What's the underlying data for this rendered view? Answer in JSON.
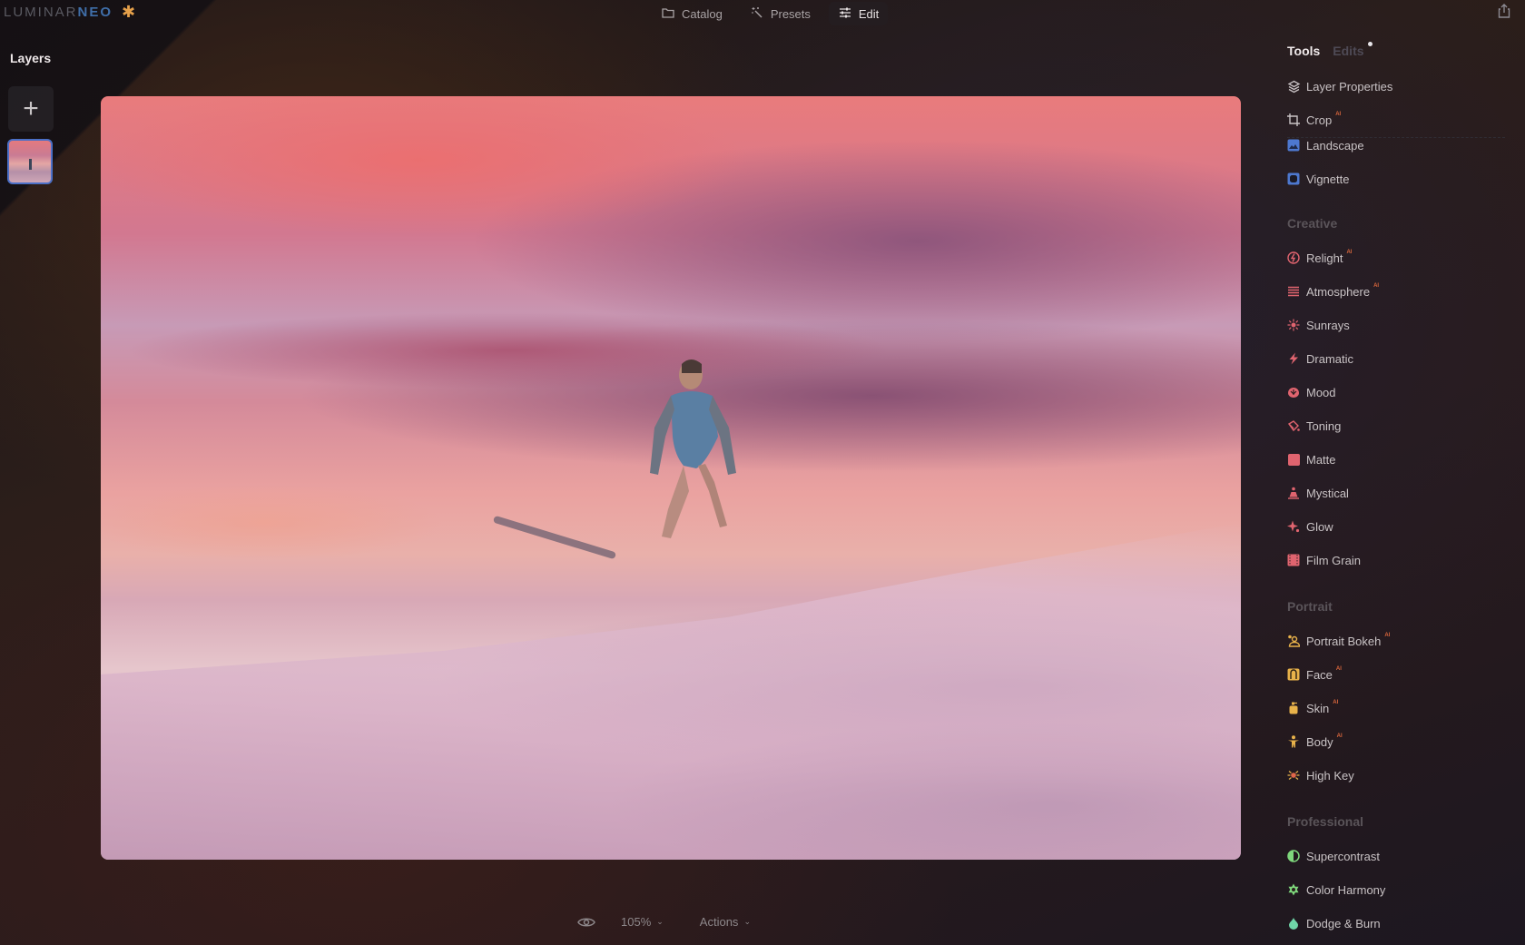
{
  "app": {
    "logo_part1": "LUMINAR",
    "logo_part2": "NEO",
    "extensions_icon": "puzzle-icon"
  },
  "topnav": [
    {
      "label": "Catalog",
      "icon": "folder-icon",
      "active": false
    },
    {
      "label": "Presets",
      "icon": "magic-wand-icon",
      "active": false
    },
    {
      "label": "Edit",
      "icon": "sliders-icon",
      "active": true
    }
  ],
  "share_icon": "share-icon",
  "layers": {
    "title": "Layers",
    "add_label": "+",
    "thumbnail": "surfer-photo-thumbnail"
  },
  "photo": {
    "description": "Surfer on a wave at sunset with pink and purple clouds"
  },
  "right_panel": {
    "tabs": [
      {
        "label": "Tools",
        "active": true
      },
      {
        "label": "Edits",
        "active": false,
        "has_dot": true
      }
    ],
    "ai_badge": "AI",
    "top_items": [
      {
        "label": "Layer Properties",
        "icon": "layers-icon",
        "ai": false
      },
      {
        "label": "Crop",
        "icon": "crop-icon",
        "ai": true
      },
      {
        "label": "Landscape",
        "icon": "landscape-icon",
        "ai": false
      },
      {
        "label": "Vignette",
        "icon": "vignette-icon",
        "ai": false
      }
    ],
    "sections": [
      {
        "title": "Creative",
        "items": [
          {
            "label": "Relight",
            "icon": "relight-icon",
            "ai": true
          },
          {
            "label": "Atmosphere",
            "icon": "atmosphere-icon",
            "ai": true
          },
          {
            "label": "Sunrays",
            "icon": "sunrays-icon",
            "ai": false
          },
          {
            "label": "Dramatic",
            "icon": "lightning-icon",
            "ai": false
          },
          {
            "label": "Mood",
            "icon": "mood-icon",
            "ai": false
          },
          {
            "label": "Toning",
            "icon": "paint-bucket-icon",
            "ai": false
          },
          {
            "label": "Matte",
            "icon": "matte-square-icon",
            "ai": false
          },
          {
            "label": "Mystical",
            "icon": "mystical-icon",
            "ai": false
          },
          {
            "label": "Glow",
            "icon": "sparkle-icon",
            "ai": false
          },
          {
            "label": "Film Grain",
            "icon": "film-icon",
            "ai": false
          }
        ]
      },
      {
        "title": "Portrait",
        "items": [
          {
            "label": "Portrait Bokeh",
            "icon": "portrait-bokeh-icon",
            "ai": true
          },
          {
            "label": "Face",
            "icon": "face-icon",
            "ai": true
          },
          {
            "label": "Skin",
            "icon": "skin-bottle-icon",
            "ai": true
          },
          {
            "label": "Body",
            "icon": "body-icon",
            "ai": true
          },
          {
            "label": "High Key",
            "icon": "high-key-icon",
            "ai": false
          }
        ]
      },
      {
        "title": "Professional",
        "items": [
          {
            "label": "Supercontrast",
            "icon": "half-circle-icon",
            "ai": false
          },
          {
            "label": "Color Harmony",
            "icon": "color-harmony-icon",
            "ai": false
          },
          {
            "label": "Dodge & Burn",
            "icon": "drop-icon",
            "ai": false
          }
        ]
      }
    ]
  },
  "bottombar": {
    "preview_icon": "eye-icon",
    "zoom": "105%",
    "actions": "Actions"
  },
  "colors": {
    "creative_accent": "#e0646f",
    "portrait_accent": "#e8b24a",
    "professional_accent": "#7ed67c",
    "landscape_accent": "#4d78cf",
    "ai_badge": "#d9663c"
  }
}
